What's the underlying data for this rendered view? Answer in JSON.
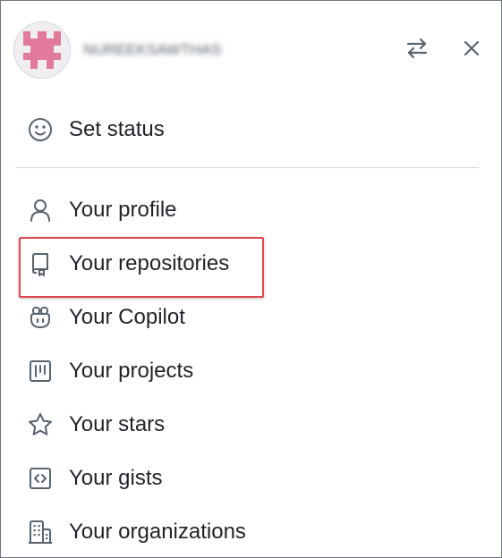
{
  "user": {
    "username": "NUREEKSAWTHAS",
    "username_blurred": true
  },
  "header": {
    "switch_account_icon": "arrow-switch-icon",
    "close_icon": "close-icon"
  },
  "status": {
    "label": "Set status",
    "icon": "smiley-icon"
  },
  "menu": {
    "items": [
      {
        "label": "Your profile",
        "icon": "person-icon"
      },
      {
        "label": "Your repositories",
        "icon": "repo-icon",
        "highlighted": true
      },
      {
        "label": "Your Copilot",
        "icon": "copilot-icon"
      },
      {
        "label": "Your projects",
        "icon": "project-icon"
      },
      {
        "label": "Your stars",
        "icon": "star-icon"
      },
      {
        "label": "Your gists",
        "icon": "code-square-icon"
      },
      {
        "label": "Your organizations",
        "icon": "organization-icon"
      }
    ]
  },
  "colors": {
    "text": "#1f2328",
    "icon": "#59636e",
    "divider": "#d0d7de",
    "highlight_border": "#e0474c",
    "avatar_pattern": "#e27a9c"
  }
}
